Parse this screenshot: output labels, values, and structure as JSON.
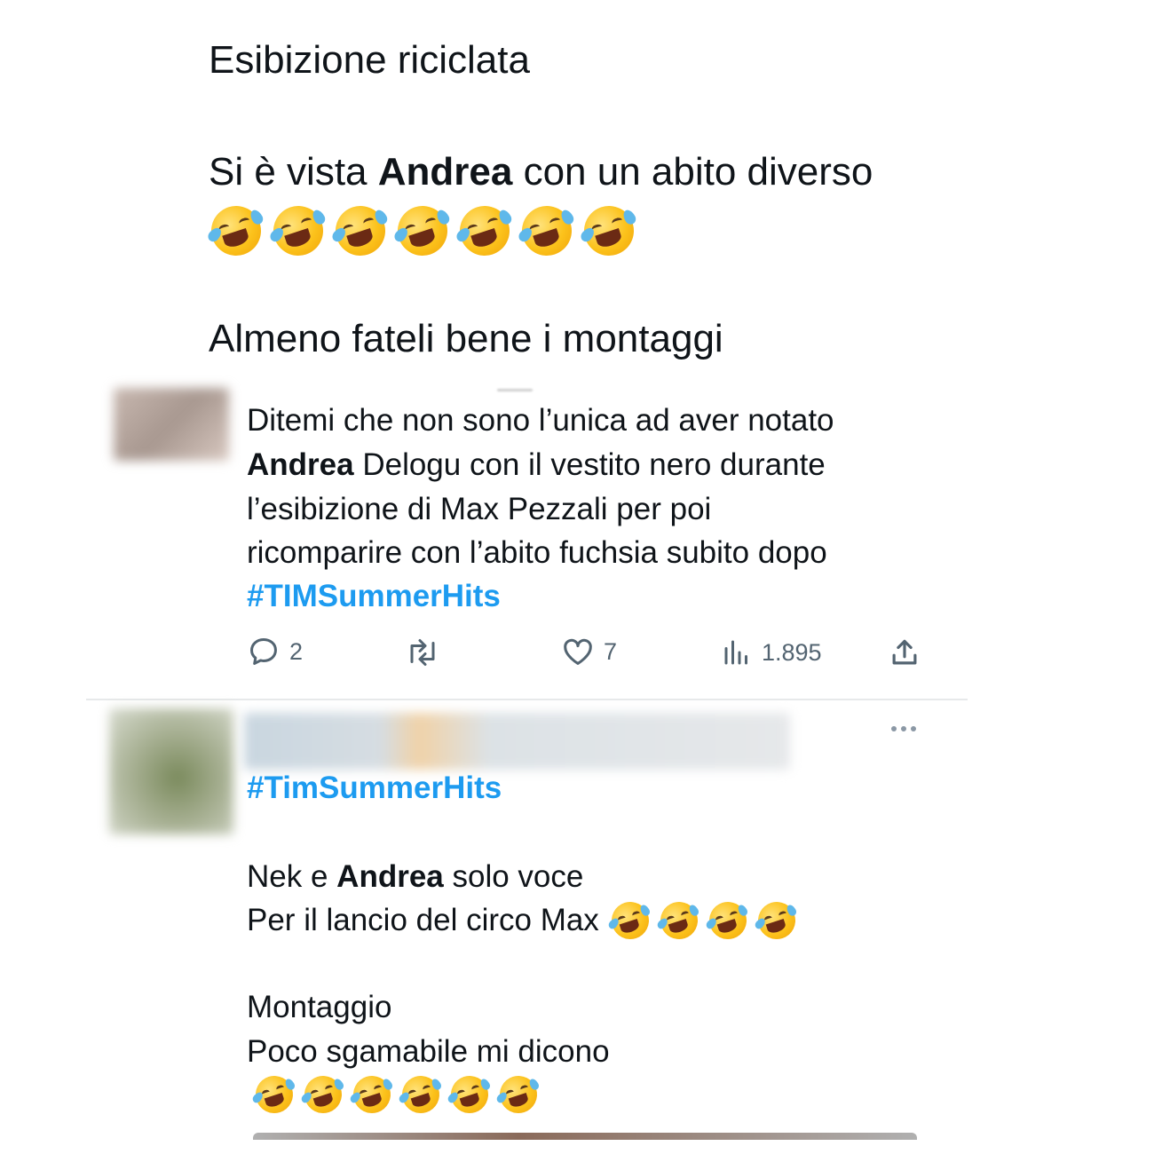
{
  "post_top": {
    "line1": "Esibizione riciclata",
    "line2_before": "Si è vista",
    "line2_bold": "Andrea",
    "line2_after": "con un abito diverso",
    "emoji_count": 7,
    "emoji_name": "rolling-on-floor-laughing",
    "line3": "Almeno fateli bene i montaggi"
  },
  "quoted": {
    "line1": "Ditemi che non sono l’unica ad aver notato",
    "line2_bold": "Andrea",
    "line2_rest": "Delogu con il vestito nero durante",
    "line3": "l’esibizione di Max Pezzali per poi",
    "line4": "ricomparire con l’abito fuchsia subito dopo",
    "hashtag": "#TIMSummerHits",
    "actions": {
      "reply_count": "2",
      "retweet_count": "",
      "like_count": "7",
      "views_count": "1.895"
    }
  },
  "reply": {
    "hashtag": "#TimSummerHits",
    "line1_before": "Nek e",
    "line1_bold": "Andrea",
    "line1_after": "solo voce",
    "line2": "Per il lancio del circo Max",
    "line2_emoji_count": 4,
    "line3": "Montaggio",
    "line4": "Poco sgamabile mi dicono",
    "line5_emoji_count": 6
  },
  "colors": {
    "text": "#0f1419",
    "accent": "#1d9bf0",
    "muted": "#536471",
    "divider": "#e7e9ea"
  }
}
